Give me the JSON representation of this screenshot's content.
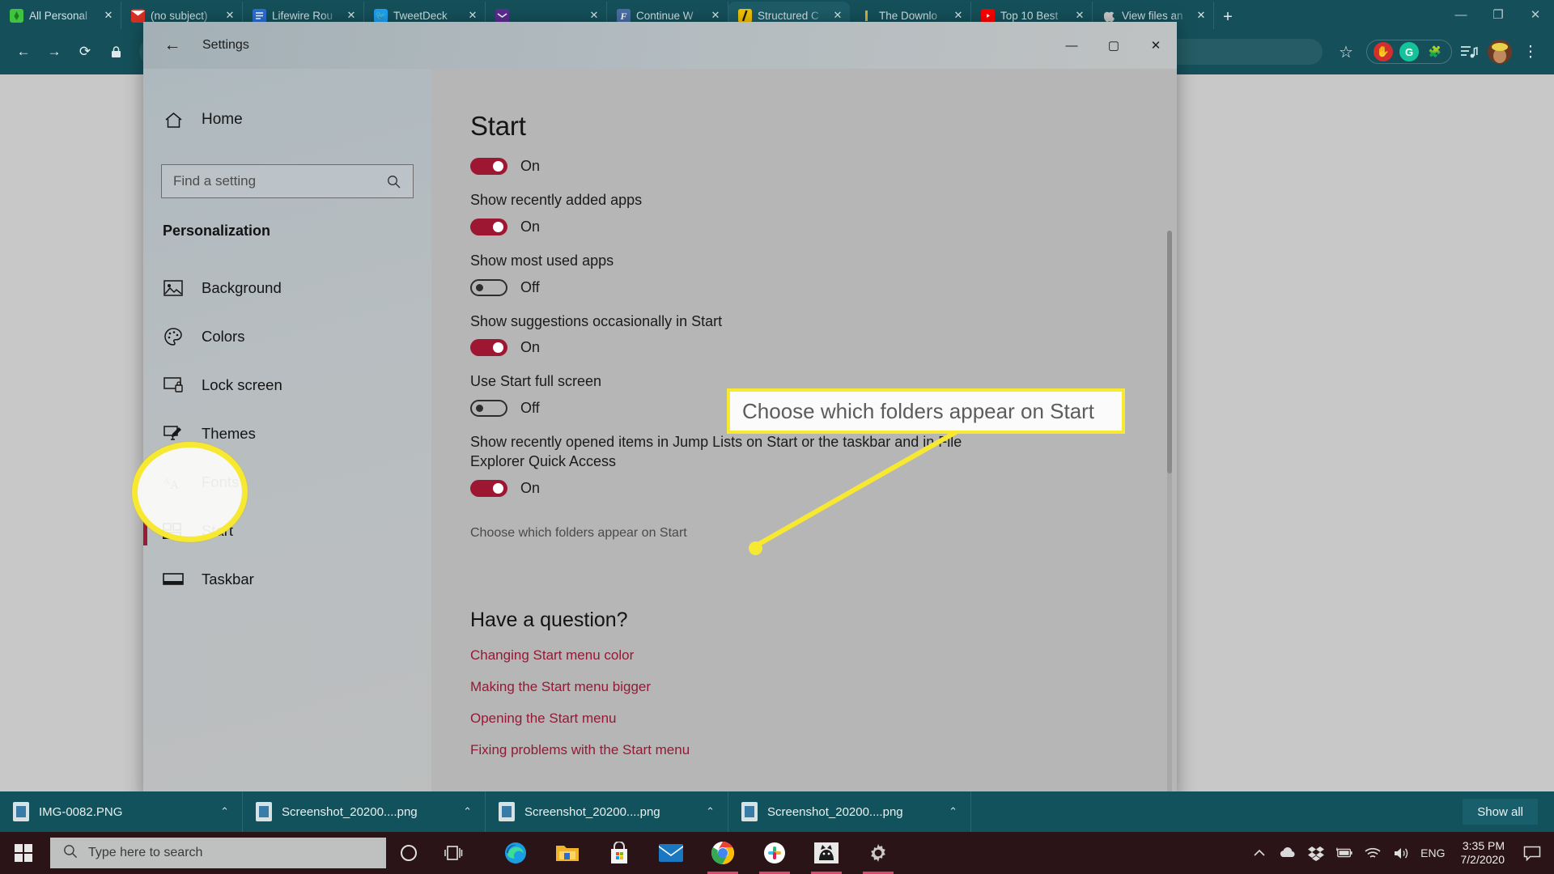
{
  "browser": {
    "tabs": [
      {
        "title": "All Personal",
        "favicon": "firefox-icon",
        "color": "#3ec43e",
        "active": false
      },
      {
        "title": "(no subject)",
        "favicon": "gmail-icon",
        "color": "#d93025",
        "active": false
      },
      {
        "title": "Lifewire Rou",
        "favicon": "document-icon",
        "color": "#2b6fd4",
        "active": false
      },
      {
        "title": "TweetDeck",
        "favicon": "twitter-icon",
        "color": "#1da1f2",
        "active": false
      },
      {
        "title": "",
        "favicon": "mail-icon",
        "color": "#5c2d91",
        "active": false
      },
      {
        "title": "Continue W",
        "favicon": "f-icon",
        "color": "#4a6fa5",
        "active": false
      },
      {
        "title": "Structured C",
        "favicon": "slash-icon",
        "color": "#f2c200",
        "active": true
      },
      {
        "title": "The Downlo",
        "favicon": "bar-icon",
        "color": "#d8b23a",
        "active": false
      },
      {
        "title": "Top 10 Best",
        "favicon": "youtube-icon",
        "color": "#ff0000",
        "active": false
      },
      {
        "title": "View files an",
        "favicon": "apple-icon",
        "color": "#bbbbbb",
        "active": false
      }
    ],
    "new_tab_label": "+",
    "close_glyph": "✕",
    "window_controls": {
      "minimize": "—",
      "maximize": "❐",
      "close": "✕"
    },
    "toolbar": {
      "back": "←",
      "forward": "→",
      "reload": "⟳",
      "lock": "🔒",
      "address_value": "",
      "star": "☆",
      "extensions": [
        {
          "name": "adblock-icon",
          "glyph": "✋",
          "bg": "#d32f2f",
          "fg": "#ffffff"
        },
        {
          "name": "grammarly-icon",
          "glyph": "G",
          "bg": "#15c39a",
          "fg": "#ffffff"
        },
        {
          "name": "puzzle-extension-icon",
          "glyph": "🧩",
          "bg": "transparent",
          "fg": "#9fd0d6"
        }
      ],
      "collections": "≡♪",
      "profile": "avatar",
      "menu": "⋮"
    }
  },
  "settings": {
    "window_title": "Settings",
    "back_glyph": "←",
    "window_controls": {
      "minimize": "—",
      "maximize": "▢",
      "close": "✕"
    },
    "sidebar": {
      "home_label": "Home",
      "home_icon": "home-icon",
      "search_placeholder": "Find a setting",
      "search_value": "",
      "search_icon": "search-icon",
      "category": "Personalization",
      "items": [
        {
          "label": "Background",
          "icon": "picture-icon",
          "selected": false
        },
        {
          "label": "Colors",
          "icon": "palette-icon",
          "selected": false
        },
        {
          "label": "Lock screen",
          "icon": "lock-screen-icon",
          "selected": false
        },
        {
          "label": "Themes",
          "icon": "themes-brush-icon",
          "selected": false
        },
        {
          "label": "Fonts",
          "icon": "fonts-aa-icon",
          "selected": false
        },
        {
          "label": "Start",
          "icon": "start-tiles-icon",
          "selected": true
        },
        {
          "label": "Taskbar",
          "icon": "taskbar-icon",
          "selected": false
        }
      ]
    },
    "content": {
      "title": "Start",
      "settings": [
        {
          "label": "",
          "state": "On",
          "on": true
        },
        {
          "label": "Show recently added apps",
          "state": "On",
          "on": true
        },
        {
          "label": "Show most used apps",
          "state": "Off",
          "on": false
        },
        {
          "label": "Show suggestions occasionally in Start",
          "state": "On",
          "on": true
        },
        {
          "label": "Use Start full screen",
          "state": "Off",
          "on": false
        },
        {
          "label": "Show recently opened items in Jump Lists on Start or the taskbar and in File Explorer Quick Access",
          "state": "On",
          "on": true
        }
      ],
      "folders_link": "Choose which folders appear on Start",
      "faq_title": "Have a question?",
      "faq_links": [
        "Changing Start menu color",
        "Making the Start menu bigger",
        "Opening the Start menu",
        "Fixing problems with the Start menu"
      ]
    }
  },
  "annotations": {
    "callout_text": "Choose which folders appear on Start",
    "highlight_color": "#f7e831",
    "circled_item": "Start"
  },
  "downloads": {
    "items": [
      {
        "name": "IMG-0082.PNG",
        "caret": "⌃"
      },
      {
        "name": "Screenshot_20200....png",
        "caret": "⌃"
      },
      {
        "name": "Screenshot_20200....png",
        "caret": "⌃"
      },
      {
        "name": "Screenshot_20200....png",
        "caret": "⌃"
      }
    ],
    "show_all_label": "Show all"
  },
  "taskbar": {
    "start_icon": "windows-logo-icon",
    "search_placeholder": "Type here to search",
    "search_icon": "search-icon",
    "cortana_icon": "cortana-circle-icon",
    "taskview_icon": "task-view-icon",
    "apps": [
      {
        "name": "edge-icon",
        "running": false
      },
      {
        "name": "file-explorer-icon",
        "running": false
      },
      {
        "name": "microsoft-store-icon",
        "running": false
      },
      {
        "name": "mail-icon",
        "running": false
      },
      {
        "name": "chrome-icon",
        "running": true
      },
      {
        "name": "slack-icon",
        "running": true
      },
      {
        "name": "photos-cat-icon",
        "running": true
      },
      {
        "name": "settings-gear-icon",
        "running": true
      }
    ],
    "tray": {
      "chevron": "⌃",
      "icons": [
        "onedrive-cloud-icon",
        "dropbox-icon",
        "battery-icon",
        "wifi-icon",
        "volume-icon"
      ],
      "language": "ENG",
      "time": "3:35 PM",
      "date": "7/2/2020",
      "notification_icon": "notification-icon"
    }
  },
  "colors": {
    "browser_chrome": "#15505a",
    "accent_red": "#9d1733",
    "highlight_yellow": "#f7e831",
    "taskbar": "#2b1418"
  }
}
